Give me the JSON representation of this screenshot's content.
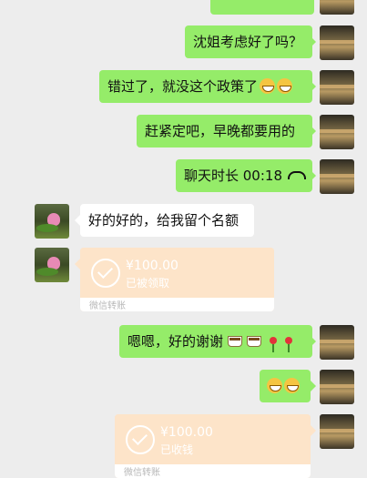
{
  "messages": {
    "m1": "沈姐考虑好了吗？",
    "m2": "错过了，就没这个政策了",
    "m3": "赶紧定吧，早晚都要用的",
    "m4": "聊天时长 00:18",
    "m5": "好的好的，给我留个名额",
    "m7": "嗯嗯，好的谢谢"
  },
  "transfers": {
    "received": {
      "amount": "¥100.00",
      "status": "已被领取",
      "label": "微信转账"
    },
    "sent": {
      "amount": "¥100.00",
      "status": "已收钱",
      "label": "微信转账"
    }
  },
  "icons": {
    "grin": "grinning-face-icon",
    "phone": "phone-hangup-icon",
    "coffee": "coffee-cup-icon",
    "rose": "rose-icon",
    "check": "check-circle-icon"
  },
  "colors": {
    "bubble_green": "#95ec69",
    "bubble_white": "#ffffff",
    "transfer_bg": "#fde4c9",
    "background": "#ededed"
  }
}
